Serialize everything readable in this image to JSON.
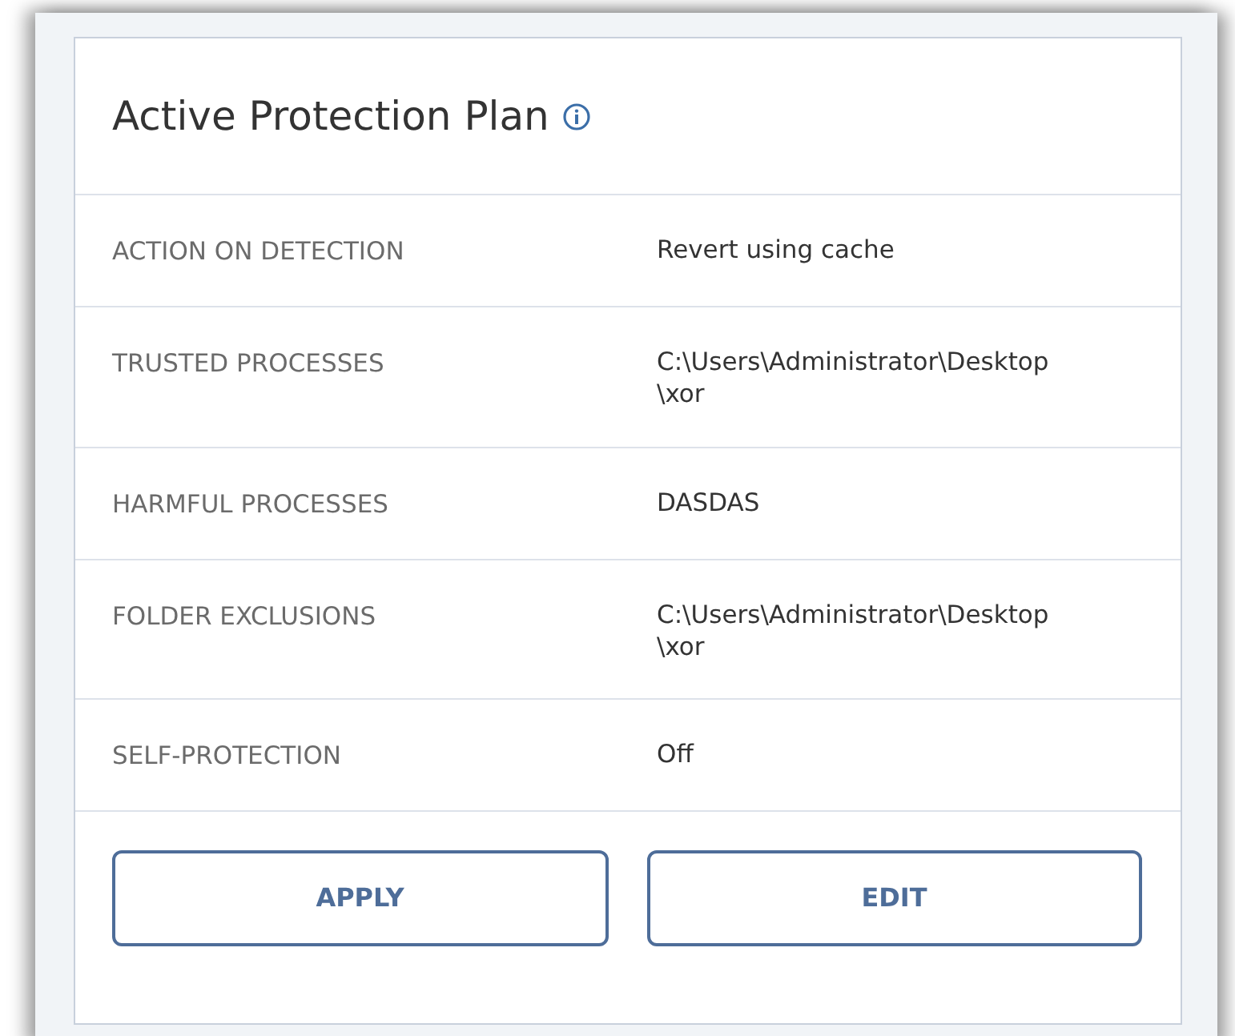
{
  "card": {
    "title": "Active Protection Plan"
  },
  "rows": [
    {
      "label": "ACTION ON DETECTION",
      "value": "Revert using cache"
    },
    {
      "label": "TRUSTED PROCESSES",
      "value": "C:\\Users\\Administrator\\Desktop\\xor"
    },
    {
      "label": "HARMFUL PROCESSES",
      "value": "DASDAS"
    },
    {
      "label": "FOLDER EXCLUSIONS",
      "value": "C:\\Users\\Administrator\\Desktop\\xor"
    },
    {
      "label": "SELF-PROTECTION",
      "value": "Off"
    }
  ],
  "buttons": [
    "APPLY",
    "EDIT"
  ]
}
